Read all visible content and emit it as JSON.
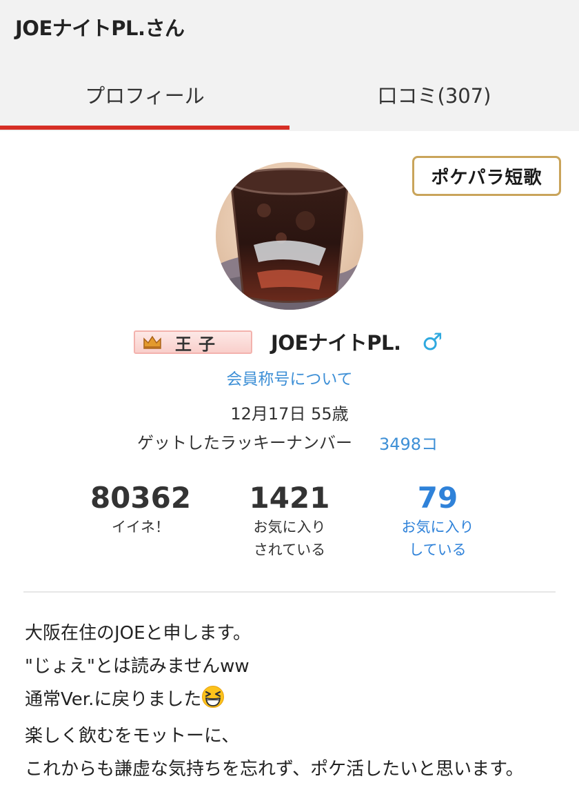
{
  "header": {
    "title": "JOEナイトPL.さん",
    "tabs": [
      {
        "label": "プロフィール",
        "active": true
      },
      {
        "label": "口コミ(307)",
        "active": false
      }
    ]
  },
  "profile": {
    "badge_button": "ポケパラ短歌",
    "title_badge": "王子",
    "username": "JOEナイトPL.",
    "gender_icon": "male-symbol",
    "gender_symbol": "♂",
    "rank_link": "会員称号について",
    "birthday": "12月17日 55歳",
    "lucky_number_label": "ゲットしたラッキーナンバー",
    "lucky_number_count": "3498コ"
  },
  "stats": [
    {
      "value": "80362",
      "label": "イイネ！"
    },
    {
      "value": "1421",
      "label": "お気に入り\nされている"
    },
    {
      "value": "79",
      "label": "お気に入り\nしている"
    }
  ],
  "bio": {
    "lines": [
      "大阪在住のJOEと申します。",
      "\"じょえ\"とは読みませんww",
      "通常Ver.に戻りました",
      "楽しく飲むをモットーに、",
      "これからも謙虚な気持ちを忘れず、ポケ活したいと思います。"
    ],
    "emoji": "grinning-squinting-face"
  },
  "colors": {
    "accent_red": "#d62f25",
    "link_blue": "#3d8fd6",
    "gender_blue": "#2fa9df",
    "badge_gold": "#c9a45a"
  }
}
